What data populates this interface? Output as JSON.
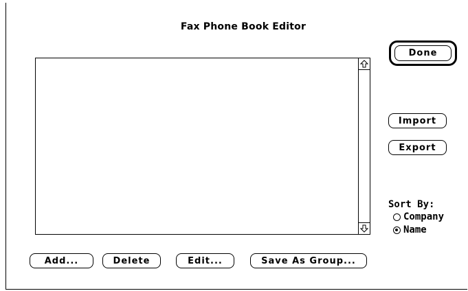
{
  "dialog": {
    "title": "Fax Phone Book Editor"
  },
  "list": {
    "items": []
  },
  "buttons": {
    "done": "Done",
    "import": "Import",
    "export": "Export",
    "add": "Add...",
    "delete": "Delete",
    "edit": "Edit...",
    "save_as_group": "Save As Group..."
  },
  "sort": {
    "label": "Sort By:",
    "options": [
      {
        "label": "Company",
        "selected": false
      },
      {
        "label": "Name",
        "selected": true
      }
    ]
  },
  "icons": {
    "scroll_up": "scroll-up-arrow-icon",
    "scroll_down": "scroll-down-arrow-icon"
  }
}
